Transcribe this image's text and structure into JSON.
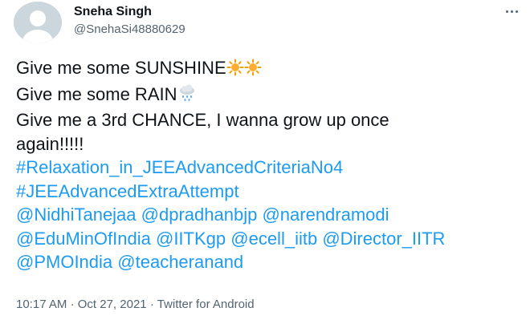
{
  "user": {
    "name": "Sneha Singh",
    "handle": "@SnehaSi48880629"
  },
  "tweet": {
    "line1": "Give me some SUNSHINE",
    "line2": "Give me some RAIN",
    "line3": "Give me a 3rd CHANCE, I wanna grow up once",
    "line4": "again!!!!!",
    "hashtag1": "#Relaxation_in_JEEAdvancedCriteriaNo4",
    "hashtag2": "#JEEAdvancedExtraAttempt",
    "mentions": {
      "m1": "@NidhiTanejaa",
      "m2": "@dpradhanbjp",
      "m3": "@narendramodi",
      "m4": "@EduMinOfIndia",
      "m5": "@IITKgp",
      "m6": "@ecell_iitb",
      "m7": "@Director_IITR",
      "m8": "@PMOIndia",
      "m9": "@teacheranand"
    },
    "emoji": [
      "sun-emoji",
      "sun-emoji",
      "rain-cloud-emoji"
    ]
  },
  "meta": {
    "time": "10:17 AM",
    "date": "Oct 27, 2021",
    "source": "Twitter for Android",
    "separator": "·"
  },
  "colors": {
    "link": "#1d9bf0",
    "text": "#0f1419",
    "secondary": "#536471",
    "avatar_bg": "#ccd6dd"
  }
}
